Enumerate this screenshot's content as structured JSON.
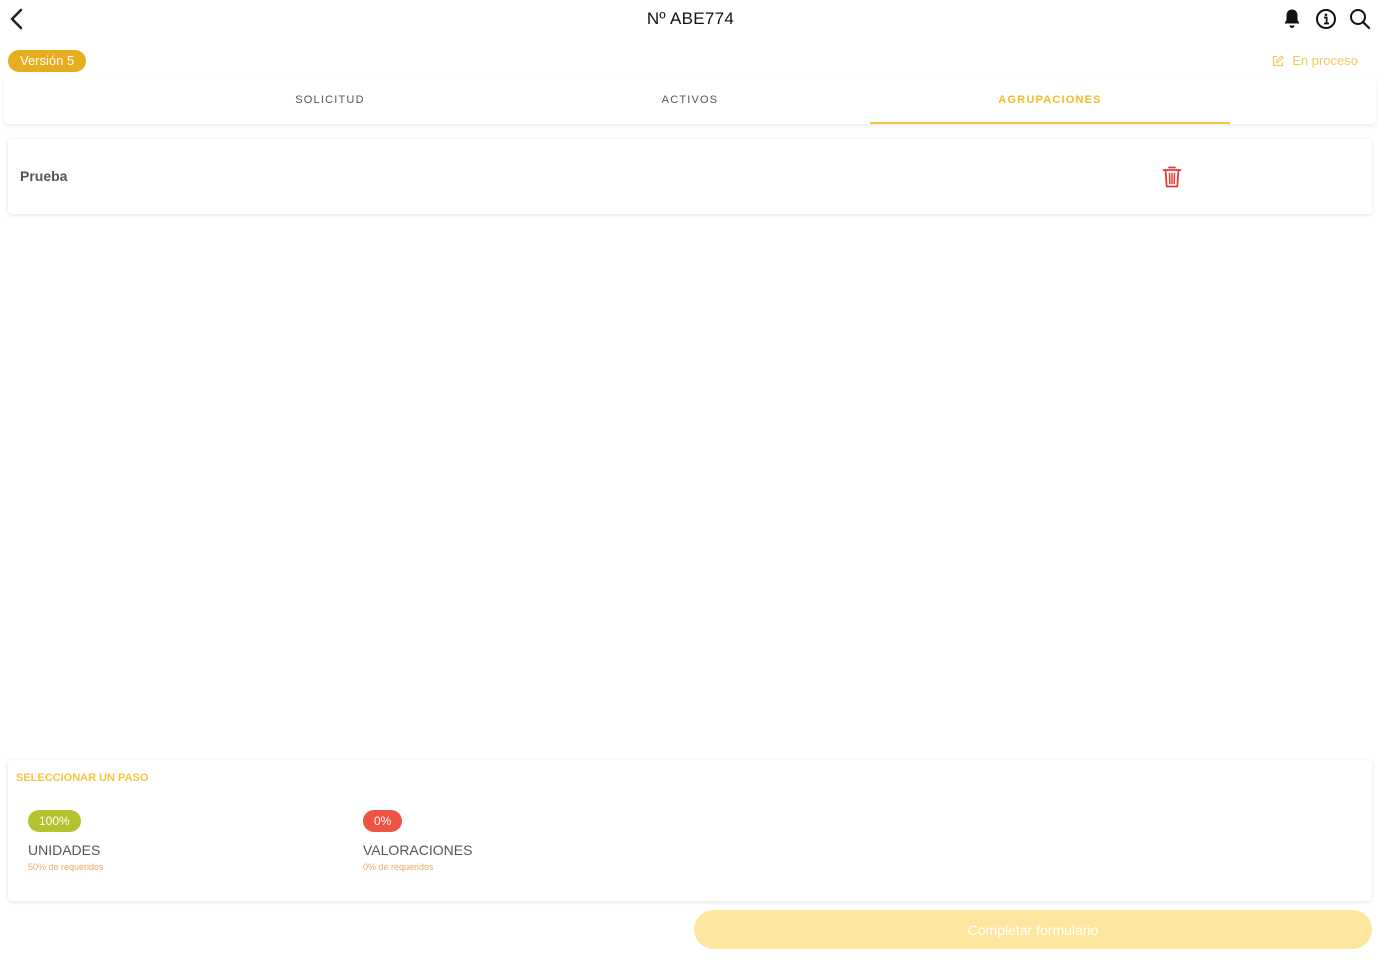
{
  "header": {
    "title": "Nº ABE774",
    "icons": [
      "chevron-left-icon",
      "bell-icon",
      "info-icon",
      "search-icon"
    ]
  },
  "meta": {
    "version_label": "Versión 5",
    "status_label": "En proceso"
  },
  "tabs": [
    {
      "label": "SOLICITUD",
      "active": false
    },
    {
      "label": "ACTIVOS",
      "active": false
    },
    {
      "label": "AGRUPACIONES",
      "active": true
    }
  ],
  "groups": [
    {
      "name": "Prueba"
    }
  ],
  "steps": {
    "title": "SELECCIONAR UN PASO",
    "items": [
      {
        "percent": "100%",
        "name": "UNIDADES",
        "required": "50% de requeridos",
        "color": "#b5c22f"
      },
      {
        "percent": "0%",
        "name": "VALORACIONES",
        "required": "0% de requeridos",
        "color": "#ef5341"
      }
    ]
  },
  "actions": {
    "complete_label": "Completar formulario"
  },
  "colors": {
    "accent": "#f5c542",
    "badge": "#e6ad1e",
    "danger": "#e53935"
  }
}
